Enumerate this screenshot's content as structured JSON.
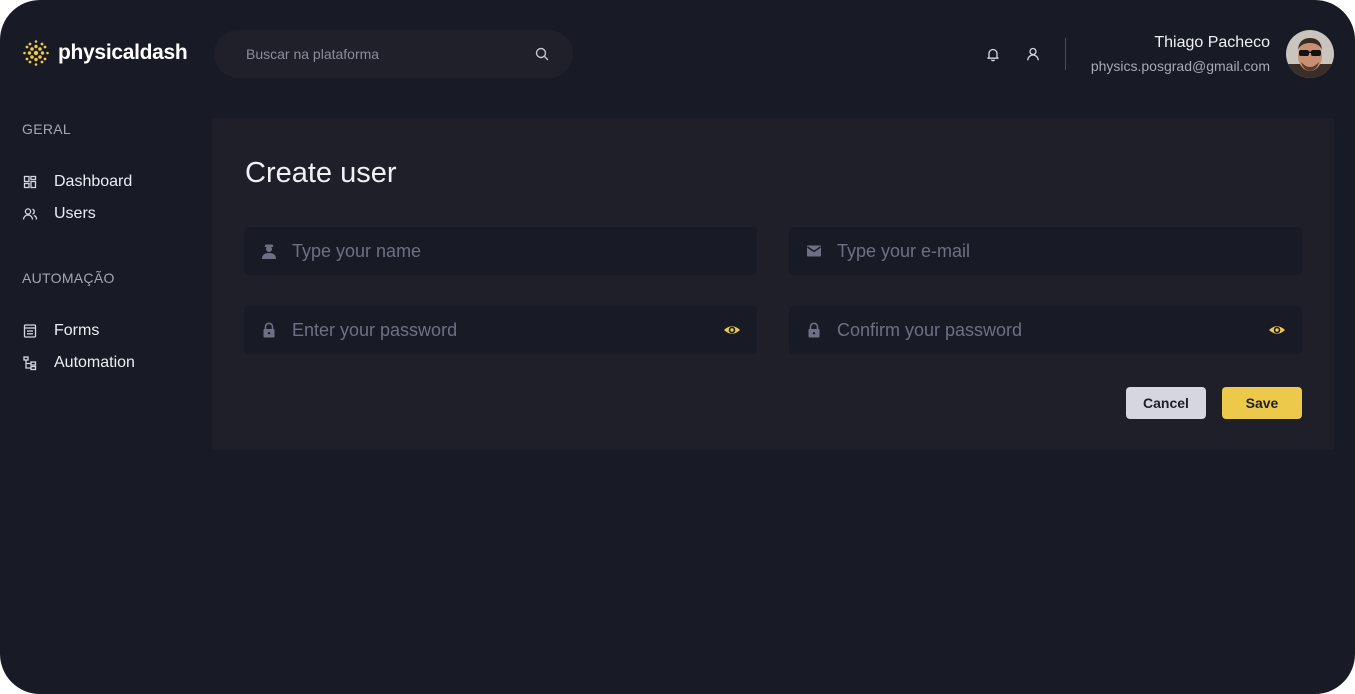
{
  "brand": {
    "name": "physicaldash",
    "accent": "#ecc94b"
  },
  "search": {
    "placeholder": "Buscar na plataforma"
  },
  "header": {
    "user": {
      "name": "Thiago Pacheco",
      "email": "physics.posgrad@gmail.com"
    }
  },
  "sidebar": {
    "sections": [
      {
        "title": "GERAL",
        "items": [
          {
            "label": "Dashboard",
            "icon": "dashboard-icon"
          },
          {
            "label": "Users",
            "icon": "users-icon"
          }
        ]
      },
      {
        "title": "AUTOMAÇÃO",
        "items": [
          {
            "label": "Forms",
            "icon": "forms-icon"
          },
          {
            "label": "Automation",
            "icon": "automation-icon"
          }
        ]
      }
    ]
  },
  "main": {
    "title": "Create user",
    "fields": {
      "name": {
        "placeholder": "Type your name",
        "icon": "user-icon"
      },
      "email": {
        "placeholder": "Type your e-mail",
        "icon": "mail-icon"
      },
      "password": {
        "placeholder": "Enter your password",
        "icon": "lock-icon"
      },
      "confirm_password": {
        "placeholder": "Confirm your password",
        "icon": "lock-icon"
      }
    },
    "buttons": {
      "cancel": "Cancel",
      "save": "Save"
    }
  }
}
